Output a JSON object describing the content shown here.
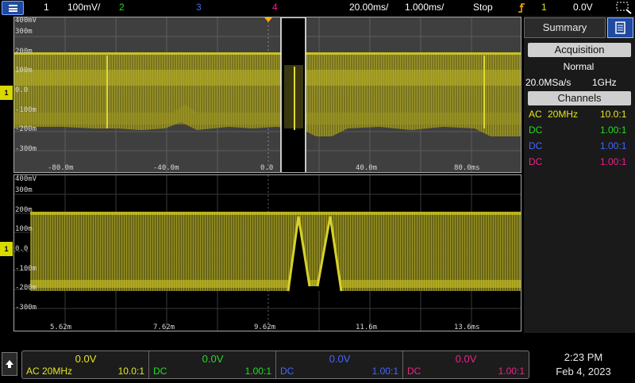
{
  "colors": {
    "ch1": "#e5e520",
    "ch2": "#22dd22",
    "ch3": "#4466ff",
    "ch4": "#ee2288",
    "trigger": "#ffaa00"
  },
  "topbar": {
    "ch1_num": "1",
    "ch1_scale": "100mV/",
    "ch2_num": "2",
    "ch3_num": "3",
    "ch4_num": "4",
    "timebase": "20.00ms/",
    "zoom_timebase": "1.000ms/",
    "run_state": "Stop",
    "trigger_source": "1",
    "trigger_level": "0.0V"
  },
  "upper": {
    "volt_labels": [
      "400mV",
      "300m",
      "200m",
      "100m",
      "0.0",
      "-100m",
      "-200m",
      "-300m"
    ],
    "time_labels": [
      "-80.0m",
      "-40.0m",
      "0.0",
      "40.0m",
      "80.0ms"
    ]
  },
  "lower": {
    "volt_labels": [
      "400mV",
      "300m",
      "200m",
      "100m",
      "0.0",
      "-100m",
      "-200m",
      "-300m"
    ],
    "time_labels": [
      "5.62m",
      "7.62m",
      "9.62m",
      "11.6m",
      "13.6ms"
    ]
  },
  "markers": {
    "ground_label": "1"
  },
  "right_panel": {
    "tab_label": "Summary",
    "acq_header": "Acquisition",
    "acq_mode": "Normal",
    "sample_rate": "20.0MSa/s",
    "bandwidth": "1GHz",
    "channels_header": "Channels",
    "channels": [
      {
        "coupling": "AC",
        "bw": "20MHz",
        "probe": "10.0:1"
      },
      {
        "coupling": "DC",
        "bw": "",
        "probe": "1.00:1"
      },
      {
        "coupling": "DC",
        "bw": "",
        "probe": "1.00:1"
      },
      {
        "coupling": "DC",
        "bw": "",
        "probe": "1.00:1"
      }
    ]
  },
  "bottom": {
    "channels": [
      {
        "offset": "0.0V",
        "coupling": "AC 20MHz",
        "probe": "10.0:1"
      },
      {
        "offset": "0.0V",
        "coupling": "DC",
        "probe": "1.00:1"
      },
      {
        "offset": "0.0V",
        "coupling": "DC",
        "probe": "1.00:1"
      },
      {
        "offset": "0.0V",
        "coupling": "DC",
        "probe": "1.00:1"
      }
    ],
    "time": "2:23 PM",
    "date": "Feb 4, 2023"
  },
  "icons": [
    "menu-icon",
    "trigger-edge-icon",
    "zoom-region-icon",
    "summary-panel-icon",
    "scroll-up-icon"
  ]
}
